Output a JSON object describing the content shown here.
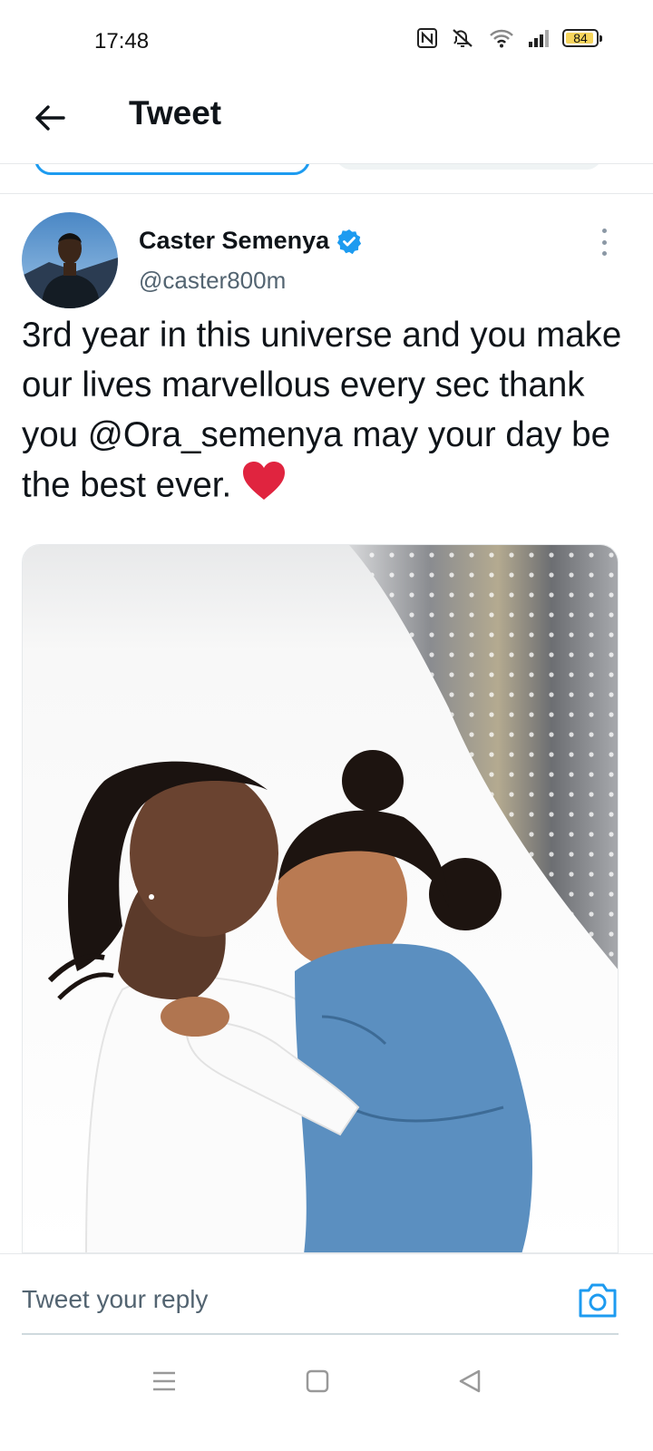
{
  "status_bar": {
    "time": "17:48",
    "battery_level": "84",
    "icons": [
      "nfc-icon",
      "mute-icon",
      "wifi-icon",
      "signal-icon",
      "battery-icon"
    ]
  },
  "header": {
    "title": "Tweet",
    "back_icon": "back-arrow-icon"
  },
  "tweet": {
    "author_name": "Caster Semenya",
    "verified": true,
    "author_handle": "@caster800m",
    "text_before": "3rd year in this universe and you make our lives marvellous every sec thank you ",
    "mention": "@Ora_semenya",
    "text_after": " may your day be the best ever. ",
    "emoji": "red-heart",
    "media_description_icon": "photo-image"
  },
  "reply": {
    "placeholder": "Tweet your reply",
    "camera_icon": "camera-icon"
  },
  "nav": {
    "items": [
      "menu-icon",
      "home-icon",
      "back-icon"
    ]
  },
  "colors": {
    "accent": "#1d9bf0",
    "heart": "#e0245e",
    "text": "#0f1419",
    "secondary_text": "#536471"
  }
}
